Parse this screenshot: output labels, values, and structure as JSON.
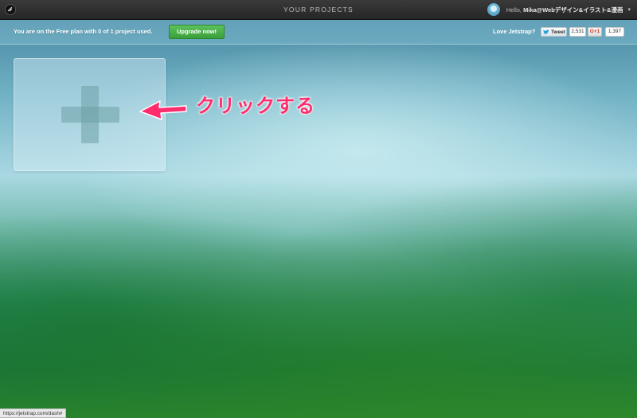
{
  "topbar": {
    "title": "YOUR PROJECTS",
    "hello_prefix": "Hello, ",
    "username": "Mika@Webデザイン&イラスト&漫画",
    "icons": {
      "logo": "jetstrap-logo-icon",
      "avatar": "user-avatar",
      "caret": "caret-down-icon"
    }
  },
  "planbar": {
    "message": "You are on the Free plan with 0 of 1 project used.",
    "upgrade_label": "Upgrade now!",
    "love_label": "Love Jetstrap?",
    "tweet_label": "Tweet",
    "tweet_count": "2,531",
    "gplus_label": "G+1",
    "gplus_count": "1,397"
  },
  "projects": {
    "new_project_icon": "plus-icon"
  },
  "annotation": {
    "text": "クリックする",
    "color": "#ff2d6e"
  },
  "status": {
    "url": "https://jetstrap.com/dash#"
  },
  "colors": {
    "upgrade_button": "#4cb34c",
    "topbar": "#2e2e2e"
  }
}
